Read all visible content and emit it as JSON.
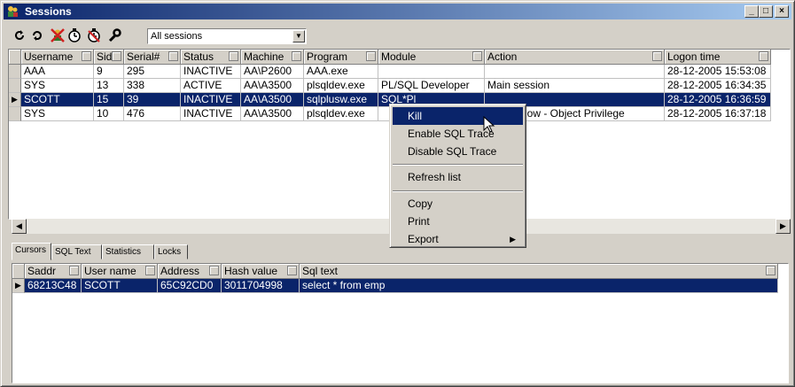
{
  "window": {
    "title": "Sessions",
    "minimize_glyph": "_",
    "maximize_glyph": "□",
    "close_glyph": "×"
  },
  "toolbar": {
    "filter_value": "All sessions"
  },
  "sessions": {
    "columns": [
      "Username",
      "Sid",
      "Serial#",
      "Status",
      "Machine",
      "Program",
      "Module",
      "Action",
      "Logon time"
    ],
    "rows": [
      [
        "AAA",
        "9",
        "295",
        "INACTIVE",
        "AA\\P2600",
        "AAA.exe",
        "",
        "",
        "28-12-2005 15:53:08"
      ],
      [
        "SYS",
        "13",
        "338",
        "ACTIVE",
        "AA\\A3500",
        "plsqldev.exe",
        "PL/SQL Developer",
        "Main session",
        "28-12-2005 16:34:35"
      ],
      [
        "SCOTT",
        "15",
        "39",
        "INACTIVE",
        "AA\\A3500",
        "sqlplusw.exe",
        "SQL*Pl",
        "",
        "28-12-2005 16:36:59"
      ],
      [
        "SYS",
        "10",
        "476",
        "INACTIVE",
        "AA\\A3500",
        "plsqldev.exe",
        "",
        "ort Window - Object Privilege",
        "28-12-2005 16:37:18"
      ]
    ]
  },
  "tabs": [
    "Cursors",
    "SQL Text",
    "Statistics",
    "Locks"
  ],
  "cursors": {
    "columns": [
      "Saddr",
      "User name",
      "Address",
      "Hash value",
      "Sql text"
    ],
    "rows": [
      [
        "68213C48",
        "SCOTT",
        "65C92CD0",
        "3011704998",
        "select * from emp"
      ]
    ]
  },
  "context_menu": {
    "kill": "Kill",
    "enable_trace": "Enable SQL Trace",
    "disable_trace": "Disable SQL Trace",
    "refresh": "Refresh list",
    "copy": "Copy",
    "print": "Print",
    "export": "Export"
  }
}
